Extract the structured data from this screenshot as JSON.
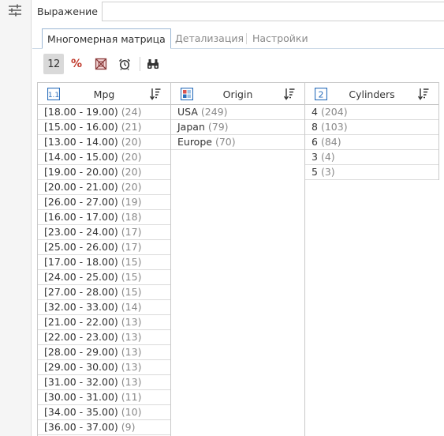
{
  "expression": {
    "label": "Выражение",
    "value": "",
    "placeholder": ""
  },
  "tabs": [
    {
      "label": "Многомерная матрица",
      "active": true
    },
    {
      "label": "Детализация",
      "active": false
    },
    {
      "label": "Настройки",
      "active": false
    }
  ],
  "toolbar": {
    "count_label": "12",
    "percent_label": "%",
    "icons": [
      "count-icon",
      "percent-icon",
      "crossed-box-icon",
      "alarm-clock-icon",
      "binoculars-icon"
    ]
  },
  "columns": {
    "mpg": {
      "name": "Mpg",
      "type_icon": "numeric-type-icon",
      "rows": [
        {
          "label": "[18.00 - 19.00)",
          "count": "(24)"
        },
        {
          "label": "[15.00 - 16.00)",
          "count": "(21)"
        },
        {
          "label": "[13.00 - 14.00)",
          "count": "(20)"
        },
        {
          "label": "[14.00 - 15.00)",
          "count": "(20)"
        },
        {
          "label": "[19.00 - 20.00)",
          "count": "(20)"
        },
        {
          "label": "[20.00 - 21.00)",
          "count": "(20)"
        },
        {
          "label": "[26.00 - 27.00)",
          "count": "(19)"
        },
        {
          "label": "[16.00 - 17.00)",
          "count": "(18)"
        },
        {
          "label": "[23.00 - 24.00)",
          "count": "(17)"
        },
        {
          "label": "[25.00 - 26.00)",
          "count": "(17)"
        },
        {
          "label": "[17.00 - 18.00)",
          "count": "(15)"
        },
        {
          "label": "[24.00 - 25.00)",
          "count": "(15)"
        },
        {
          "label": "[27.00 - 28.00)",
          "count": "(15)"
        },
        {
          "label": "[32.00 - 33.00)",
          "count": "(14)"
        },
        {
          "label": "[21.00 - 22.00)",
          "count": "(13)"
        },
        {
          "label": "[22.00 - 23.00)",
          "count": "(13)"
        },
        {
          "label": "[28.00 - 29.00)",
          "count": "(13)"
        },
        {
          "label": "[29.00 - 30.00)",
          "count": "(13)"
        },
        {
          "label": "[31.00 - 32.00)",
          "count": "(13)"
        },
        {
          "label": "[30.00 - 31.00)",
          "count": "(11)"
        },
        {
          "label": "[34.00 - 35.00)",
          "count": "(10)"
        },
        {
          "label": "[36.00 - 37.00)",
          "count": "(9)"
        }
      ]
    },
    "origin": {
      "name": "Origin",
      "type_icon": "category-type-icon",
      "rows": [
        {
          "label": "USA",
          "count": "(249)"
        },
        {
          "label": "Japan",
          "count": "(79)"
        },
        {
          "label": "Europe",
          "count": "(70)"
        }
      ]
    },
    "cylinders": {
      "name": "Cylinders",
      "type_icon": "integer-type-icon",
      "type_label": "2",
      "rows": [
        {
          "label": "4",
          "count": "(204)"
        },
        {
          "label": "8",
          "count": "(103)"
        },
        {
          "label": "6",
          "count": "(84)"
        },
        {
          "label": "3",
          "count": "(4)"
        },
        {
          "label": "5",
          "count": "(3)"
        }
      ]
    }
  },
  "colors": {
    "accent_blue": "#2a6ebb",
    "percent_red": "#c0392b",
    "tab_border": "#9bb7d4"
  }
}
